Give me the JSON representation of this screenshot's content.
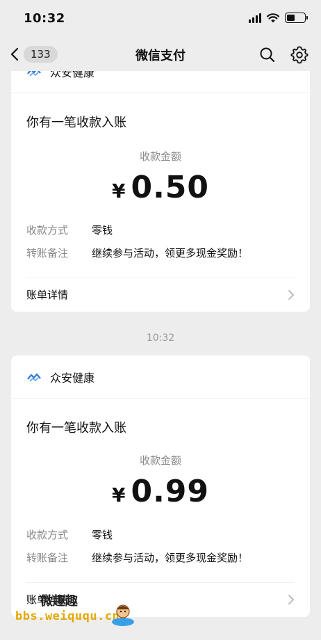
{
  "status_bar": {
    "time": "10:32",
    "battery_level": 0.45
  },
  "nav": {
    "back_badge": "133",
    "title": "微信支付"
  },
  "cards": [
    {
      "merchant": "众安健康",
      "notice": "你有一笔收款入账",
      "amount_label": "收款金额",
      "currency": "¥",
      "amount": "0.50",
      "method_label": "收款方式",
      "method_value": "零钱",
      "remark_label": "转账备注",
      "remark_value": "继续参与活动，领更多现金奖励！",
      "detail_label": "账单详情"
    },
    {
      "merchant": "众安健康",
      "notice": "你有一笔收款入账",
      "amount_label": "收款金额",
      "currency": "¥",
      "amount": "0.99",
      "method_label": "收款方式",
      "method_value": "零钱",
      "remark_label": "转账备注",
      "remark_value": "继续参与活动，领更多现金奖励！",
      "detail_label": "账单详情"
    }
  ],
  "time_separator": "10:32",
  "watermark": {
    "name": "微趣趣",
    "url": "bbs.weiququ.cn"
  },
  "icons": {
    "back": "chevron-left-icon",
    "search": "search-icon",
    "settings": "gear-icon",
    "chevron": "chevron-right-icon"
  },
  "colors": {
    "background": "#ededed",
    "card": "#ffffff",
    "secondary_text": "#888888",
    "watermark_url": "#e6a800"
  }
}
